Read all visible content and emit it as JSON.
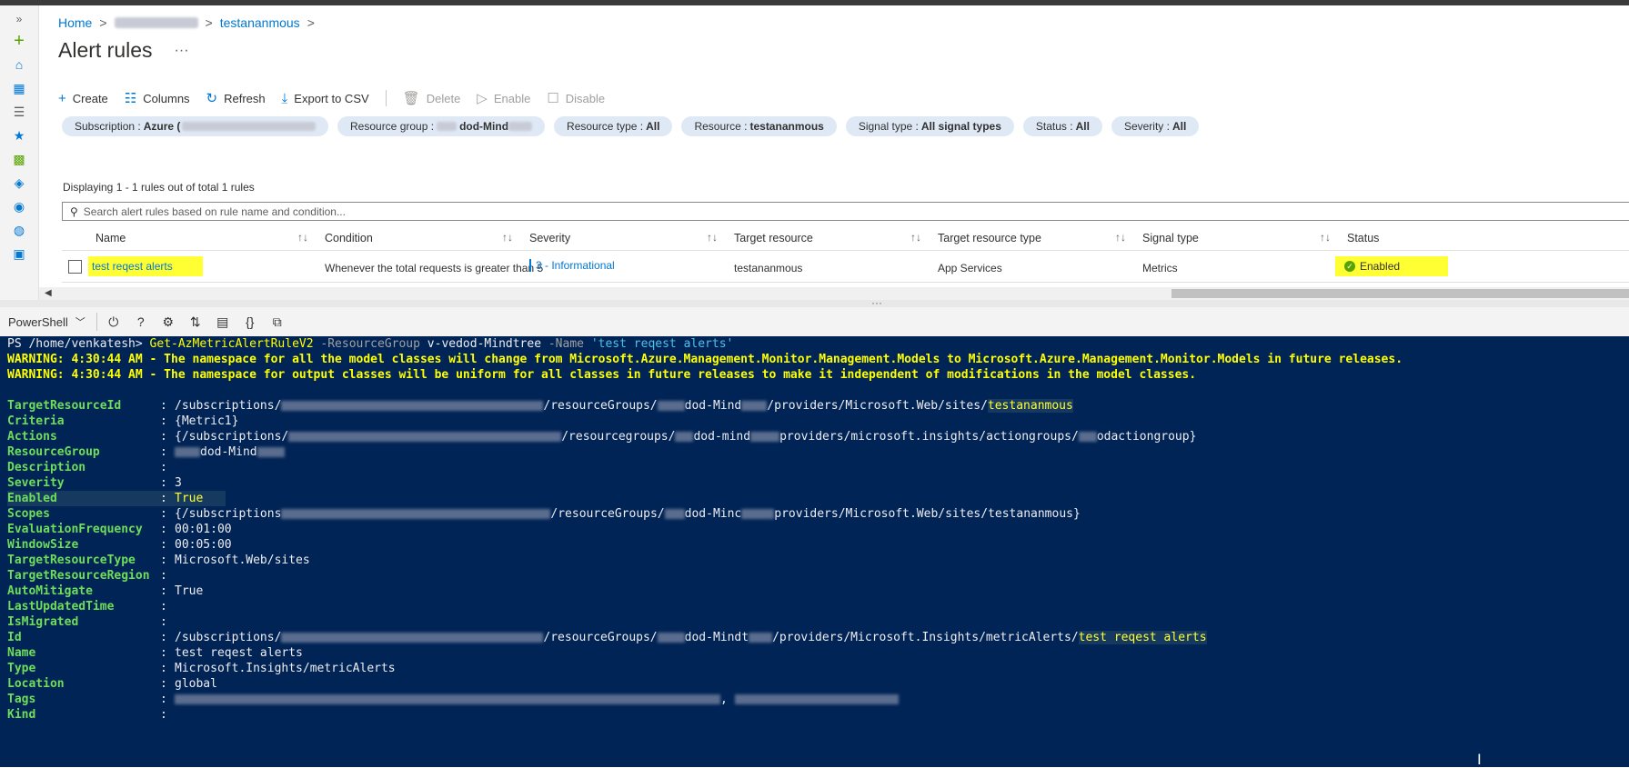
{
  "breadcrumb": {
    "home": "Home",
    "resource": "testananmous",
    "sep": ">"
  },
  "page": {
    "title": "Alert rules",
    "more": "···"
  },
  "toolbar": {
    "create": "Create",
    "columns": "Columns",
    "refresh": "Refresh",
    "export": "Export to CSV",
    "delete": "Delete",
    "enable": "Enable",
    "disable": "Disable"
  },
  "filters": {
    "subscription_label": "Subscription :",
    "subscription_value": "Azure (",
    "resource_group_label": "Resource group :",
    "resource_group_value": "dod-Mind",
    "resource_type_label": "Resource type :",
    "resource_type_value": "All",
    "resource_label": "Resource :",
    "resource_value": "testananmous",
    "signal_type_label": "Signal type :",
    "signal_type_value": "All signal types",
    "status_label": "Status :",
    "status_value": "All",
    "severity_label": "Severity :",
    "severity_value": "All"
  },
  "list": {
    "count_text": "Displaying 1 - 1 rules out of total 1 rules",
    "search_placeholder": "Search alert rules based on rule name and condition...",
    "columns": [
      "Name",
      "Condition",
      "Severity",
      "Target resource",
      "Target resource type",
      "Signal type",
      "Status"
    ],
    "sort_glyph": "↑↓",
    "row": {
      "name": "test reqest alerts",
      "condition": "Whenever the total requests is greater than 5",
      "severity": "3 - Informational",
      "target_resource": "testananmous",
      "target_resource_type": "App Services",
      "signal_type": "Metrics",
      "status": "Enabled"
    }
  },
  "cloudshell": {
    "shell": "PowerShell"
  },
  "terminal": {
    "prompt": "PS /home/venkatesh> ",
    "cmdlet": "Get-AzMetricAlertRuleV2",
    "p1": " -ResourceGroup ",
    "p1v": "v-vedod-Mindtree",
    "p2": " -Name ",
    "p2v": "'test reqest alerts'",
    "warn1": "WARNING: 4:30:44 AM - The namespace for all the model classes will change from Microsoft.Azure.Management.Monitor.Management.Models to Microsoft.Azure.Management.Monitor.Models in future releases.",
    "warn2": "WARNING: 4:30:44 AM - The namespace for output classes will be uniform for all classes in future releases to make it independent of modifications in the model classes.",
    "colon": ":",
    "fields": {
      "target_resource_id_key": "TargetResourceId",
      "target_resource_id_a": "/subscriptions/",
      "target_resource_id_b": "/resourceGroups/",
      "target_resource_id_c": "dod-Mind",
      "target_resource_id_d": "/providers/Microsoft.Web/sites/",
      "target_resource_id_e": "testananmous",
      "criteria_key": "Criteria",
      "criteria": "{Metric1}",
      "actions_key": "Actions",
      "actions_a": "{/subscriptions/",
      "actions_b": "/resourcegroups/",
      "actions_c": "dod-mind",
      "actions_d": "providers/microsoft.insights/actiongroups/",
      "actions_e": "odactiongroup}",
      "resource_group_key": "ResourceGroup",
      "resource_group": "dod-Mind",
      "description_key": "Description",
      "severity_key": "Severity",
      "severity": "3",
      "enabled_key": "Enabled",
      "enabled": "True",
      "scopes_key": "Scopes",
      "scopes_a": "{/subscriptions",
      "scopes_b": "/resourceGroups/",
      "scopes_c": "dod-Minc",
      "scopes_d": "providers/Microsoft.Web/sites/testananmous}",
      "eval_freq_key": "EvaluationFrequency",
      "eval_freq": "00:01:00",
      "window_size_key": "WindowSize",
      "window_size": "00:05:00",
      "target_type_key": "TargetResourceType",
      "target_type": "Microsoft.Web/sites",
      "target_region_key": "TargetResourceRegion",
      "auto_mitigate_key": "AutoMitigate",
      "auto_mitigate": "True",
      "last_updated_key": "LastUpdatedTime",
      "is_migrated_key": "IsMigrated",
      "id_key": "Id",
      "id_a": "/subscriptions/",
      "id_b": "/resourceGroups/",
      "id_c": "dod-Mindt",
      "id_d": "/providers/Microsoft.Insights/metricAlerts/",
      "id_e": "test reqest alerts",
      "name_key": "Name",
      "name": "test reqest alerts",
      "type_key": "Type",
      "type": "Microsoft.Insights/metricAlerts",
      "location_key": "Location",
      "location": "global",
      "tags_key": "Tags",
      "tags_sep": ",",
      "kind_key": "Kind"
    }
  },
  "colors": {
    "accent": "#0078d4",
    "terminal_bg": "#012456",
    "highlight": "#ffff33",
    "key_green": "#6ede5a"
  }
}
